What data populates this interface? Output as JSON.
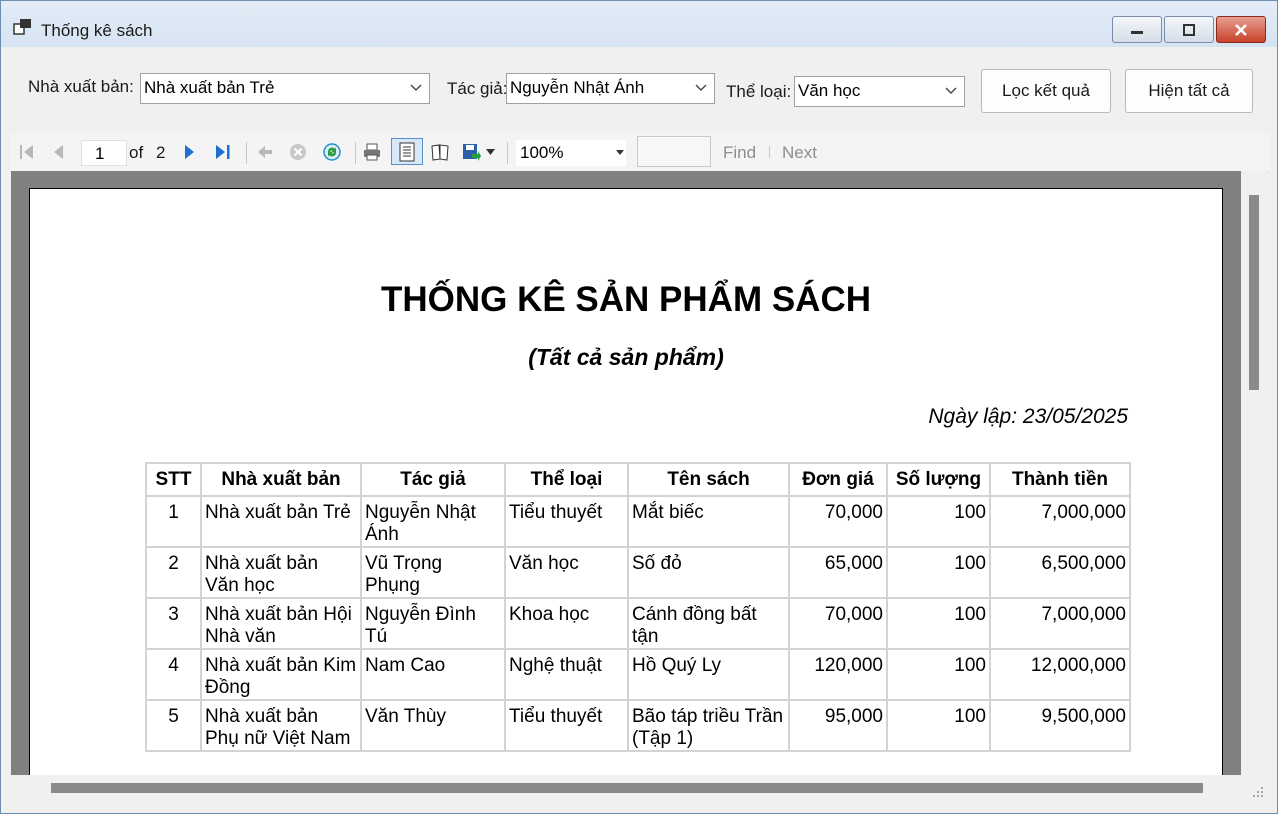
{
  "window": {
    "title": "Thống kê sách"
  },
  "filters": {
    "publisher_label": "Nhà xuất bản:",
    "publisher_value": "Nhà xuất bản Trẻ",
    "author_label": "Tác giả:",
    "author_value": "Nguyễn Nhật Ánh",
    "genre_label": "Thể loại:",
    "genre_value": "Văn học",
    "filter_button": "Lọc kết quả",
    "show_all_button": "Hiện tất cả"
  },
  "toolbar": {
    "current_page": "1",
    "of_label": "of",
    "total_pages": "2",
    "zoom": "100%",
    "find_label": "Find",
    "next_label": "Next",
    "icons": [
      "first-page-icon",
      "prev-page-icon",
      "next-page-icon",
      "last-page-icon",
      "back-icon",
      "stop-icon",
      "refresh-icon",
      "print-icon",
      "print-layout-icon",
      "page-setup-icon",
      "export-icon"
    ]
  },
  "report": {
    "title": "THỐNG KÊ SẢN PHẨM SÁCH",
    "subtitle": "(Tất cả sản phẩm)",
    "date": "Ngày lập: 23/05/2025",
    "columns": [
      "STT",
      "Nhà xuất bản",
      "Tác giả",
      "Thể loại",
      "Tên sách",
      "Đơn giá",
      "Số lượng",
      "Thành tiền"
    ],
    "rows": [
      [
        "1",
        "Nhà xuất bản Trẻ",
        "Nguyễn Nhật Ánh",
        "Tiểu thuyết",
        "Mắt biếc",
        "70,000",
        "100",
        "7,000,000"
      ],
      [
        "2",
        "Nhà xuất bản Văn học",
        "Vũ Trọng Phụng",
        "Văn học",
        "Số đỏ",
        "65,000",
        "100",
        "6,500,000"
      ],
      [
        "3",
        "Nhà xuất bản Hội Nhà văn",
        "Nguyễn Đình Tú",
        "Khoa học",
        "Cánh đồng bất tận",
        "70,000",
        "100",
        "7,000,000"
      ],
      [
        "4",
        "Nhà xuất bản Kim Đồng",
        "Nam Cao",
        "Nghệ thuật",
        "Hồ Quý Ly",
        "120,000",
        "100",
        "12,000,000"
      ],
      [
        "5",
        "Nhà xuất bản Phụ nữ Việt Nam",
        "Văn Thùy",
        "Tiểu thuyết",
        "Bão táp triều Trần (Tập 1)",
        "95,000",
        "100",
        "9,500,000"
      ]
    ]
  },
  "colors": {
    "titlebar": "#d6e3f2",
    "close_button": "#c8412a",
    "nav_blue": "#1f6fd0"
  }
}
